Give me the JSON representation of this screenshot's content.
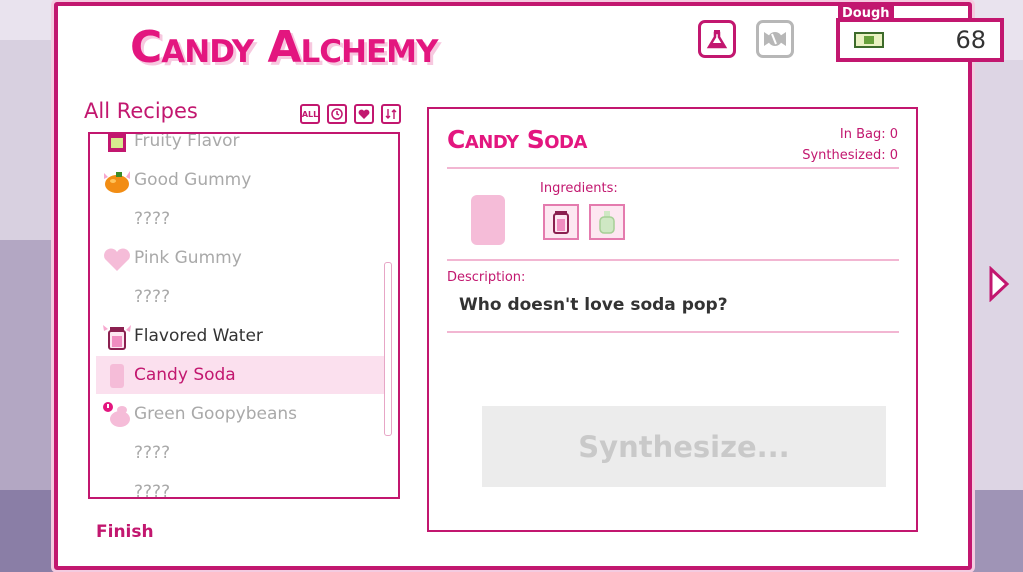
{
  "game": {
    "title": "Candy Alchemy"
  },
  "currency": {
    "label": "Dough",
    "value": "68"
  },
  "top_buttons": [
    {
      "icon": "flask-icon",
      "active": true
    },
    {
      "icon": "candy-icon",
      "active": false
    }
  ],
  "recipes": {
    "heading": "All Recipes",
    "filters": [
      {
        "label": "ALL",
        "icon": "all-filter"
      },
      {
        "icon": "clock-icon"
      },
      {
        "icon": "heart-icon"
      },
      {
        "icon": "sort-icon"
      }
    ],
    "items": [
      {
        "name": "Fruity Flavor",
        "state": "known",
        "icon": "fruity-flavor-icon"
      },
      {
        "name": "Good Gummy",
        "state": "known",
        "icon": "orange-gummy-icon"
      },
      {
        "name": "????",
        "state": "unknown"
      },
      {
        "name": "Pink Gummy",
        "state": "known",
        "icon": "pink-heart-gummy-icon"
      },
      {
        "name": "????",
        "state": "unknown"
      },
      {
        "name": "Flavored Water",
        "state": "available",
        "icon": "jar-icon"
      },
      {
        "name": "Candy Soda",
        "state": "selected",
        "icon": "soda-icon"
      },
      {
        "name": "Green Goopybeans",
        "state": "known",
        "icon": "goopybean-icon"
      },
      {
        "name": "????",
        "state": "unknown"
      },
      {
        "name": "????",
        "state": "unknown"
      }
    ],
    "finish_label": "Finish"
  },
  "detail": {
    "title": "Candy Soda",
    "in_bag": "In Bag: 0",
    "synthesized": "Synthesized: 0",
    "ingredients_label": "Ingredients:",
    "ingredients": [
      {
        "icon": "flavored-water-jar-icon"
      },
      {
        "icon": "green-bottle-icon"
      }
    ],
    "description_label": "Description:",
    "description": "Who doesn't love soda pop?",
    "synthesize_label": "Synthesize..."
  },
  "colors": {
    "accent": "#c2176f",
    "title_pink": "#e3167f",
    "selected_row": "#fbe0ee",
    "disabled_button": "#ececec"
  }
}
